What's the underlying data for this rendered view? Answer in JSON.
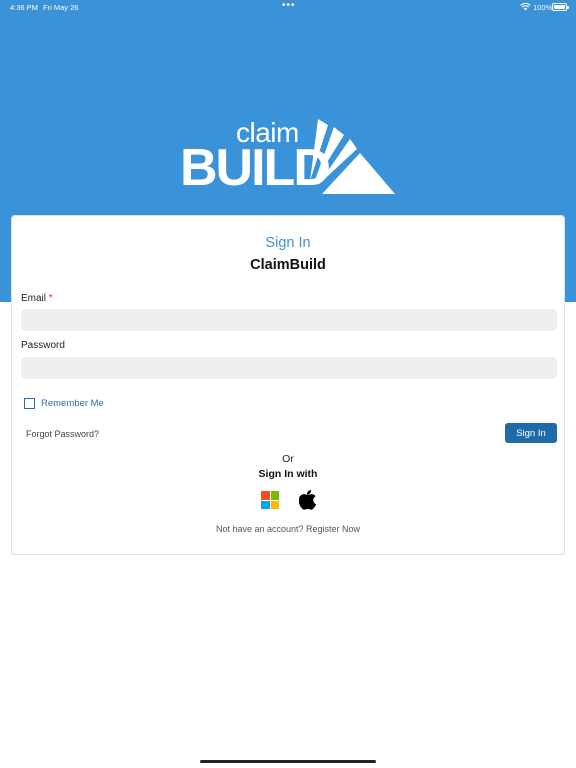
{
  "status_bar": {
    "time": "4:36 PM",
    "date": "Fri May 26",
    "dots": "•••",
    "battery": "100%"
  },
  "brand": {
    "claim": "claim",
    "build": "BUILD",
    "primary_color": "#3a93d8"
  },
  "card": {
    "heading": "Sign In",
    "subheading": "ClaimBuild"
  },
  "form": {
    "email_label": "Email",
    "required_marker": "*",
    "email_value": "",
    "password_label": "Password",
    "password_value": "",
    "remember_me_label": "Remember Me",
    "remember_me_checked": false,
    "forgot_password": "Forgot Password?",
    "signin_button": "Sign In",
    "button_color": "#1f6aa8"
  },
  "social": {
    "or": "Or",
    "signin_with": "Sign In with",
    "providers": [
      {
        "icon": "microsoft-icon"
      },
      {
        "icon": "apple-icon"
      }
    ]
  },
  "footer": {
    "register": "Not have an account? Register Now"
  }
}
